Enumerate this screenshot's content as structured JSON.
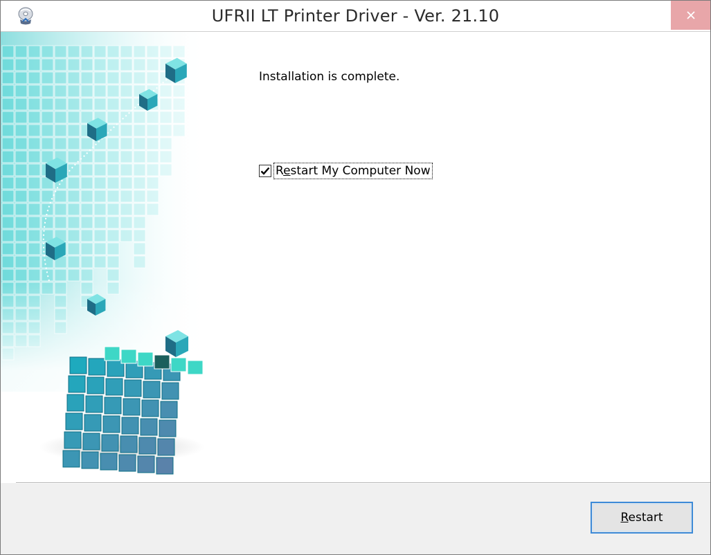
{
  "window": {
    "title": "UFRII LT Printer Driver - Ver. 21.10",
    "close_icon": "close-icon",
    "app_icon": "printer-cd-icon"
  },
  "main": {
    "message": "Installation is complete.",
    "restart_checkbox": {
      "label_first": "R",
      "label_accel": "e",
      "label_rest": "start My Computer Now",
      "checked": true
    }
  },
  "footer": {
    "restart_button": {
      "accel": "R",
      "rest": "estart"
    }
  },
  "colors": {
    "accent_cyan": "#22c3c6",
    "close_button": "#e8a6a9",
    "focus_border": "#3c8ad8"
  }
}
